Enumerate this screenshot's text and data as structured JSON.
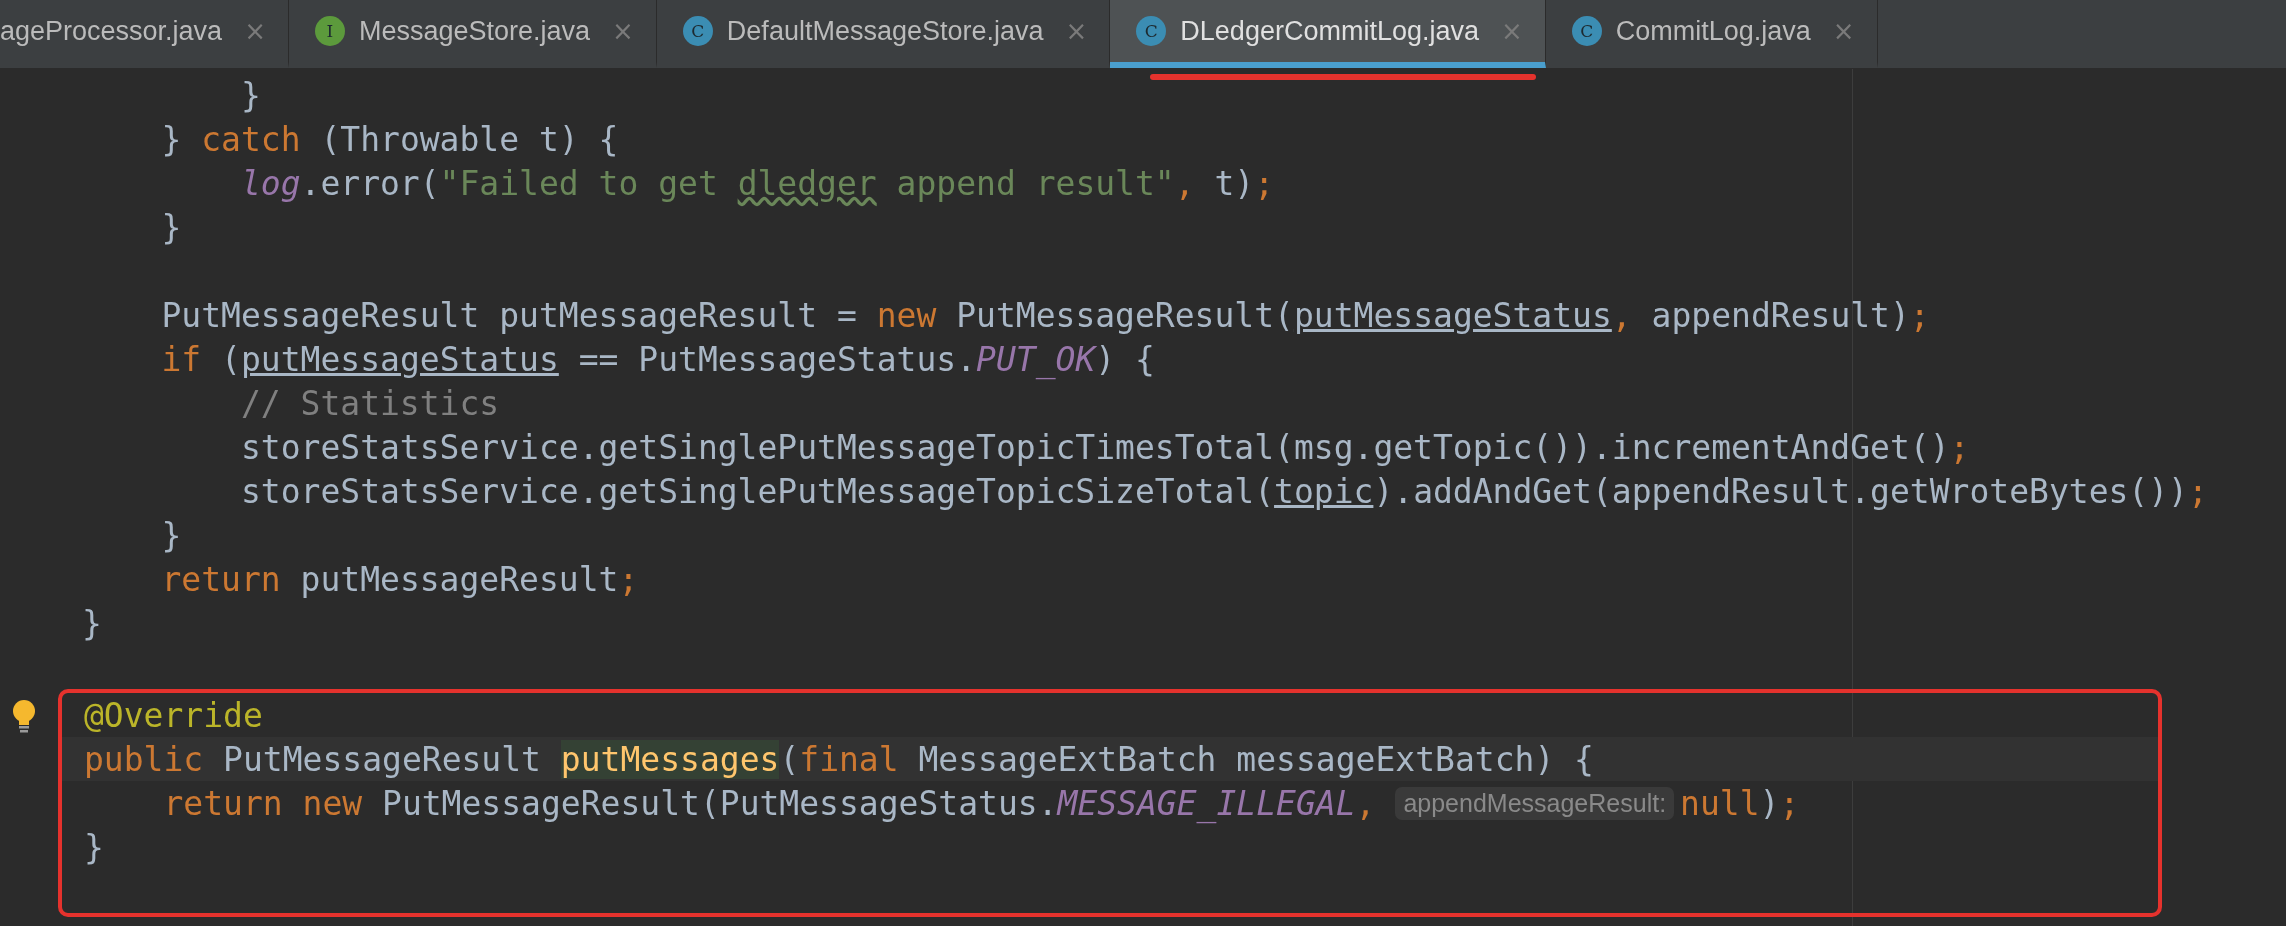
{
  "tabs": [
    {
      "label": "ageProcessor.java",
      "close": "×",
      "selected": false,
      "marked": false
    },
    {
      "label": "MessageStore.java",
      "badge": "I",
      "color": "#5c9a3c",
      "close": "×",
      "selected": false,
      "marked": false
    },
    {
      "label": "DefaultMessageStore.java",
      "badge": "C",
      "color": "#3b8db3",
      "close": "×",
      "selected": false,
      "marked": false
    },
    {
      "label": "DLedgerCommitLog.java",
      "badge": "C",
      "color": "#3b8db3",
      "close": "×",
      "selected": true,
      "marked": true
    },
    {
      "label": "CommitLog.java",
      "badge": "C",
      "color": "#3b8db3",
      "close": "×",
      "selected": false,
      "marked": false
    }
  ],
  "editor": {
    "lines": [
      {
        "kind": "group",
        "children": [
          {
            "kind": "group",
            "children": [
              {
                "kind": "code",
                "tokens": [
                  {
                    "kind": "plain",
                    "text": "}"
                  }
                ]
              }
            ]
          },
          {
            "kind": "code",
            "tokens": [
              {
                "kind": "plain",
                "text": "} "
              },
              {
                "kind": "keyword",
                "text": "catch"
              },
              {
                "kind": "plain",
                "text": " (Throwable t) {"
              }
            ],
            "children": [
              {
                "kind": "code",
                "tokens": [
                  {
                    "kind": "field",
                    "text": "log"
                  },
                  {
                    "kind": "plain",
                    "text": ".error("
                  },
                  {
                    "kind": "string",
                    "text": "\"Failed to get "
                  },
                  {
                    "kind": "typo",
                    "text": "dledger"
                  },
                  {
                    "kind": "string",
                    "text": " append result\""
                  },
                  {
                    "kind": "keyword",
                    "text": ","
                  },
                  {
                    "kind": "plain",
                    "text": " t)"
                  },
                  {
                    "kind": "keyword",
                    "text": ";"
                  }
                ]
              }
            ]
          },
          {
            "kind": "code",
            "tokens": [
              {
                "kind": "plain",
                "text": "}"
              }
            ]
          },
          {
            "kind": "blank"
          },
          {
            "kind": "code",
            "tokens": [
              {
                "kind": "plain",
                "text": "PutMessageResult putMessageResult = "
              },
              {
                "kind": "keyword",
                "text": "new"
              },
              {
                "kind": "plain",
                "text": " PutMessageResult("
              },
              {
                "kind": "param",
                "text": "putMessageStatus"
              },
              {
                "kind": "keyword",
                "text": ","
              },
              {
                "kind": "plain",
                "text": " appendResult)"
              },
              {
                "kind": "keyword",
                "text": ";"
              }
            ]
          },
          {
            "kind": "code",
            "tokens": [
              {
                "kind": "keyword",
                "text": "if"
              },
              {
                "kind": "plain",
                "text": " ("
              },
              {
                "kind": "param",
                "text": "putMessageStatus"
              },
              {
                "kind": "plain",
                "text": " == PutMessageStatus."
              },
              {
                "kind": "static",
                "text": "PUT_OK"
              },
              {
                "kind": "plain",
                "text": ") {"
              }
            ],
            "children": [
              {
                "kind": "code",
                "tokens": [
                  {
                    "kind": "comment",
                    "text": "// Statistics"
                  }
                ]
              },
              {
                "kind": "code",
                "tokens": [
                  {
                    "kind": "plain",
                    "text": "storeStatsService.getSinglePutMessageTopicTimesTotal(msg.getTopic()).incrementAndGet()"
                  },
                  {
                    "kind": "keyword",
                    "text": ";"
                  }
                ]
              },
              {
                "kind": "code",
                "tokens": [
                  {
                    "kind": "plain",
                    "text": "storeStatsService.getSinglePutMessageTopicSizeTotal("
                  },
                  {
                    "kind": "param",
                    "text": "topic"
                  },
                  {
                    "kind": "plain",
                    "text": ").addAndGet(appendResult.getWroteBytes())"
                  },
                  {
                    "kind": "keyword",
                    "text": ";"
                  }
                ]
              }
            ]
          },
          {
            "kind": "code",
            "tokens": [
              {
                "kind": "plain",
                "text": "}"
              }
            ]
          },
          {
            "kind": "code",
            "tokens": [
              {
                "kind": "keyword",
                "text": "return"
              },
              {
                "kind": "plain",
                "text": " putMessageResult"
              },
              {
                "kind": "keyword",
                "text": ";"
              }
            ]
          }
        ]
      },
      {
        "kind": "code",
        "tokens": [
          {
            "kind": "plain",
            "text": "}"
          }
        ]
      },
      {
        "kind": "blank"
      },
      {
        "kind": "frame",
        "children": [
          {
            "kind": "code",
            "bulb": true,
            "tokens": [
              {
                "kind": "annotation",
                "text": "@Override"
              }
            ]
          },
          {
            "kind": "code",
            "current": true,
            "tokens": [
              {
                "kind": "keyword",
                "text": "public"
              },
              {
                "kind": "plain",
                "text": " PutMessageResult "
              },
              {
                "kind": "declaration",
                "caret_before": true,
                "text": "putMessages"
              },
              {
                "kind": "plain",
                "text": "("
              },
              {
                "kind": "keyword",
                "text": "final"
              },
              {
                "kind": "plain",
                "text": " MessageExtBatch messageExtBatch) {"
              }
            ],
            "children": [
              {
                "kind": "code",
                "tokens": [
                  {
                    "kind": "keyword",
                    "text": "return new"
                  },
                  {
                    "kind": "plain",
                    "text": " PutMessageResult(PutMessageStatus."
                  },
                  {
                    "kind": "static",
                    "text": "MESSAGE_ILLEGAL"
                  },
                  {
                    "kind": "keyword",
                    "text": ","
                  },
                  {
                    "kind": "hint",
                    "text": "appendMessageResult:"
                  },
                  {
                    "kind": "keyword",
                    "text": "null"
                  },
                  {
                    "kind": "plain",
                    "text": ")"
                  },
                  {
                    "kind": "keyword",
                    "text": ";"
                  }
                ]
              }
            ]
          },
          {
            "kind": "code",
            "tokens": [
              {
                "kind": "plain",
                "text": "}"
              }
            ]
          },
          {
            "kind": "blank"
          }
        ]
      }
    ]
  }
}
